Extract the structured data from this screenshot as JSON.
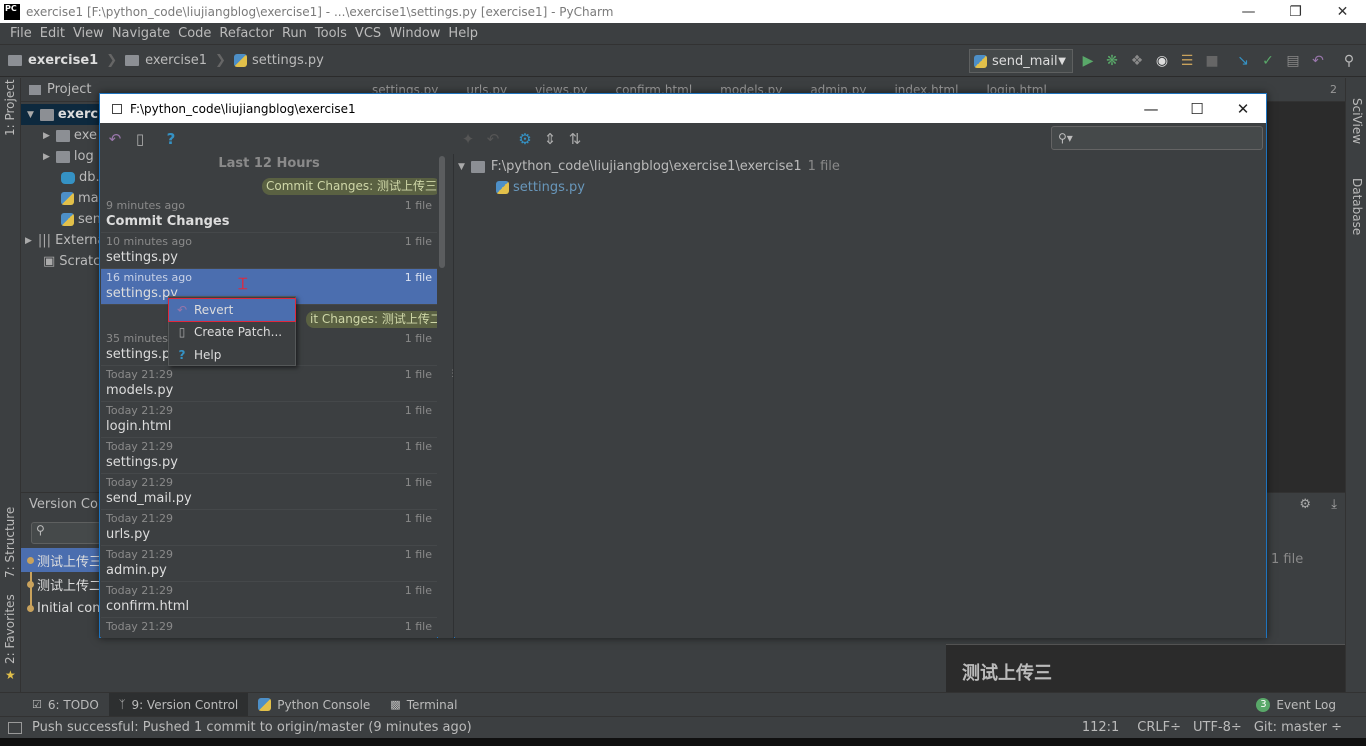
{
  "window": {
    "title": "exercise1 [F:\\python_code\\liujiangblog\\exercise1] - ...\\exercise1\\settings.py [exercise1] - PyCharm",
    "app_badge": "PC"
  },
  "menu": [
    "File",
    "Edit",
    "View",
    "Navigate",
    "Code",
    "Refactor",
    "Run",
    "Tools",
    "VCS",
    "Window",
    "Help"
  ],
  "navbar": {
    "crumbs": [
      "exercise1",
      "exercise1",
      "settings.py"
    ],
    "run_config": "send_mail"
  },
  "left_strip": {
    "project": "1: Project",
    "structure": "7: Structure",
    "favorites": "2: Favorites"
  },
  "right_strip": {
    "sciview": "SciView",
    "database": "Database"
  },
  "project_panel": {
    "title": "Project",
    "tree": [
      "exercis",
      "exe",
      "log",
      "db.",
      "ma",
      "sen",
      "Externa",
      "Scratch"
    ]
  },
  "editor_tabs": [
    "settings.py",
    "urls.py",
    "views.py",
    "confirm.html",
    "models.py",
    "admin.py",
    "index.html",
    "login.html"
  ],
  "editor_tab_count": "2",
  "vc_panel": {
    "title": "Version Con",
    "log": [
      "测试上传三",
      "测试上传二",
      "Initial com"
    ],
    "right_count": "1 file",
    "details_text": "测试上传三"
  },
  "dialog": {
    "title": "F:\\python_code\\liujiangblog\\exercise1",
    "group_header": "Last 12 Hours",
    "labels": [
      "Commit Changes: 测试上传三",
      "it Changes: 测试上传二"
    ],
    "history": [
      {
        "time": "9 minutes ago",
        "name": "Commit Changes",
        "count": "1 file",
        "bold": true
      },
      {
        "time": "10 minutes ago",
        "name": "settings.py",
        "count": "1 file"
      },
      {
        "time": "16 minutes ago",
        "name": "settings.py",
        "count": "1 file",
        "selected": true
      },
      {
        "time": "35 minutes a",
        "name": "settings.py",
        "count": "1 file"
      },
      {
        "time": "Today 21:29",
        "name": "models.py",
        "count": "1 file"
      },
      {
        "time": "Today 21:29",
        "name": "login.html",
        "count": "1 file"
      },
      {
        "time": "Today 21:29",
        "name": "settings.py",
        "count": "1 file"
      },
      {
        "time": "Today 21:29",
        "name": "send_mail.py",
        "count": "1 file"
      },
      {
        "time": "Today 21:29",
        "name": "urls.py",
        "count": "1 file"
      },
      {
        "time": "Today 21:29",
        "name": "admin.py",
        "count": "1 file"
      },
      {
        "time": "Today 21:29",
        "name": "confirm.html",
        "count": "1 file"
      },
      {
        "time": "Today 21:29",
        "name": "",
        "count": "1 file"
      }
    ],
    "changes": {
      "folder": "F:\\python_code\\liujiangblog\\exercise1\\exercise1",
      "folder_count": "1 file",
      "file": "settings.py"
    },
    "context_menu": [
      "Revert",
      "Create Patch...",
      "Help"
    ]
  },
  "bottom_tools": [
    {
      "label": "6: TODO"
    },
    {
      "label": "9: Version Control"
    },
    {
      "label": "Python Console"
    },
    {
      "label": "Terminal"
    }
  ],
  "event_log": {
    "count": "3",
    "label": "Event Log"
  },
  "status": {
    "message": "Push successful: Pushed 1 commit to origin/master (9 minutes ago)",
    "position": "112:1",
    "line_sep": "CRLF÷",
    "encoding": "UTF-8÷",
    "git": "Git: master ÷"
  },
  "colors": {
    "selection": "#4b6eaf",
    "background": "#3c3f41",
    "accent_red": "#e0283c"
  }
}
